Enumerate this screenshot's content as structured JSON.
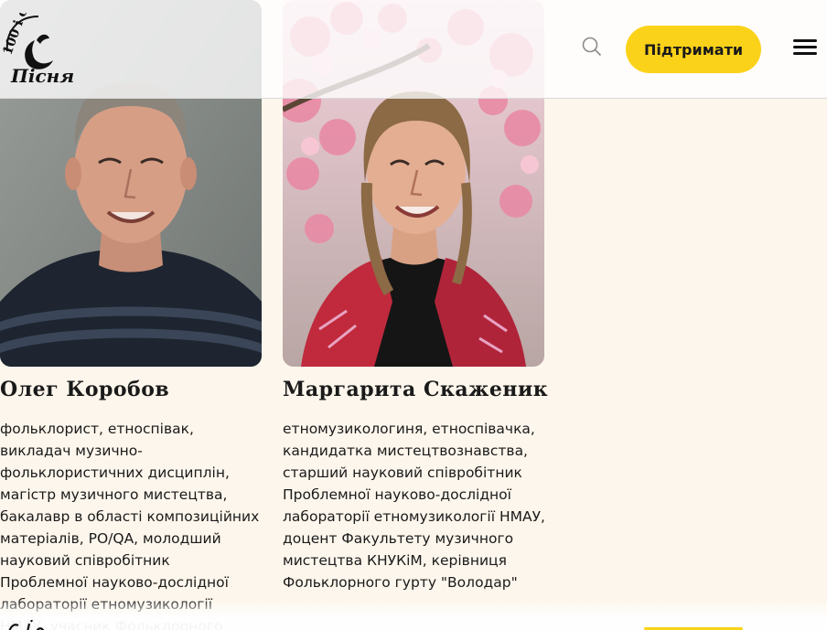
{
  "header": {
    "support_label": "Підтримати",
    "logo_text_top": "100 і одна",
    "logo_text_bottom": "Пісня"
  },
  "people": [
    {
      "name": "Олег Коробов",
      "description": "фольклорист, етноспівак, викладач музично-фольклористичних дисциплін, магістр музичного мистецтва, бакалавр в області композиційних матеріалів, PO/QA, молодший науковий співробітник Проблемної науково-дослідної лабораторії етномузикології НМАУ, учасник Фольклорного гурту"
    },
    {
      "name": "Маргарита Скаженик",
      "description": "етномузикологиня, етноспівачка, кандидатка мистецтвознавства, старший науковий співробітник Проблемної науково-дослідної лабораторії етномузикології НМАУ, доцент Факультету музичного мистецтва КНУКіМ, керівниця Фольклорного гурту \"Володар\""
    }
  ],
  "colors": {
    "accent": "#fbd21a",
    "background": "#fdf6ec",
    "text": "#1a1a1a"
  },
  "icons": [
    "search-icon",
    "menu-icon",
    "logo-icon"
  ]
}
